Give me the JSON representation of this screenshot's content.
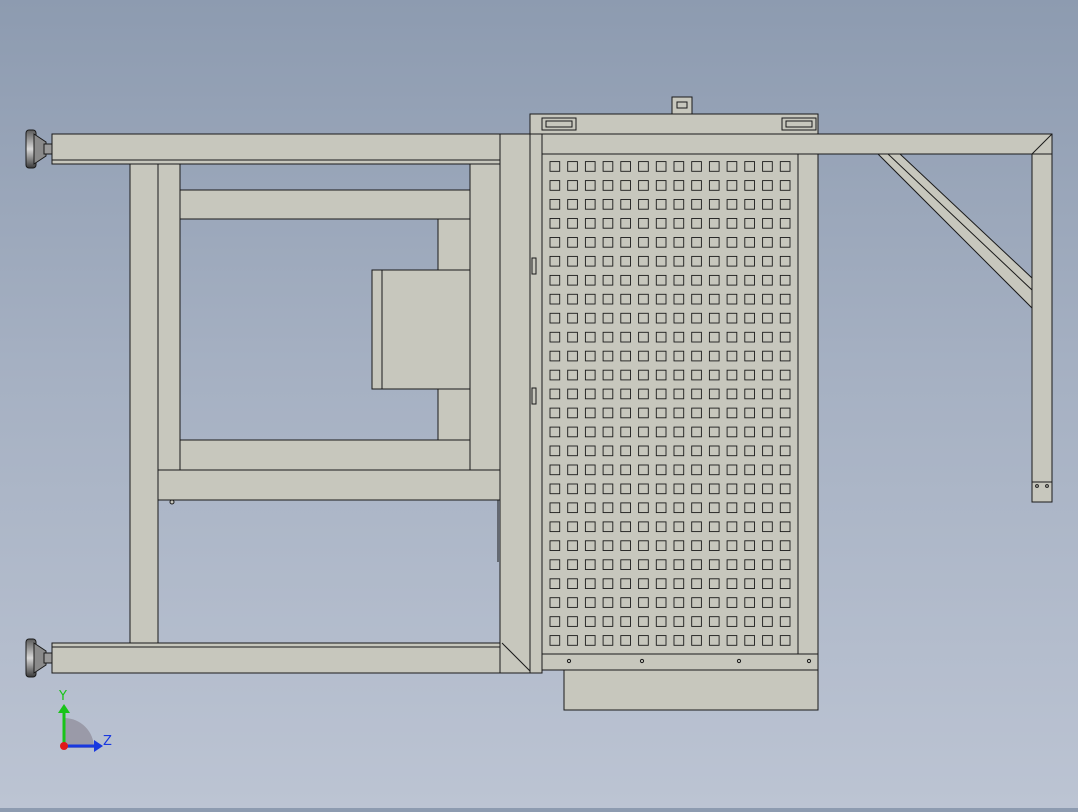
{
  "viewport": {
    "background_top": "#8d9bb0",
    "background_bottom": "#bcc4d3",
    "part_fill": "#c7c7bd",
    "edge_color": "#1a1a1a"
  },
  "triad": {
    "y_label": "Y",
    "z_label": "Z",
    "y_color": "#18c418",
    "z_color": "#1838e0",
    "x_color": "#e01818"
  },
  "model": {
    "perforated_panel": {
      "rows": 26,
      "cols": 14
    }
  }
}
